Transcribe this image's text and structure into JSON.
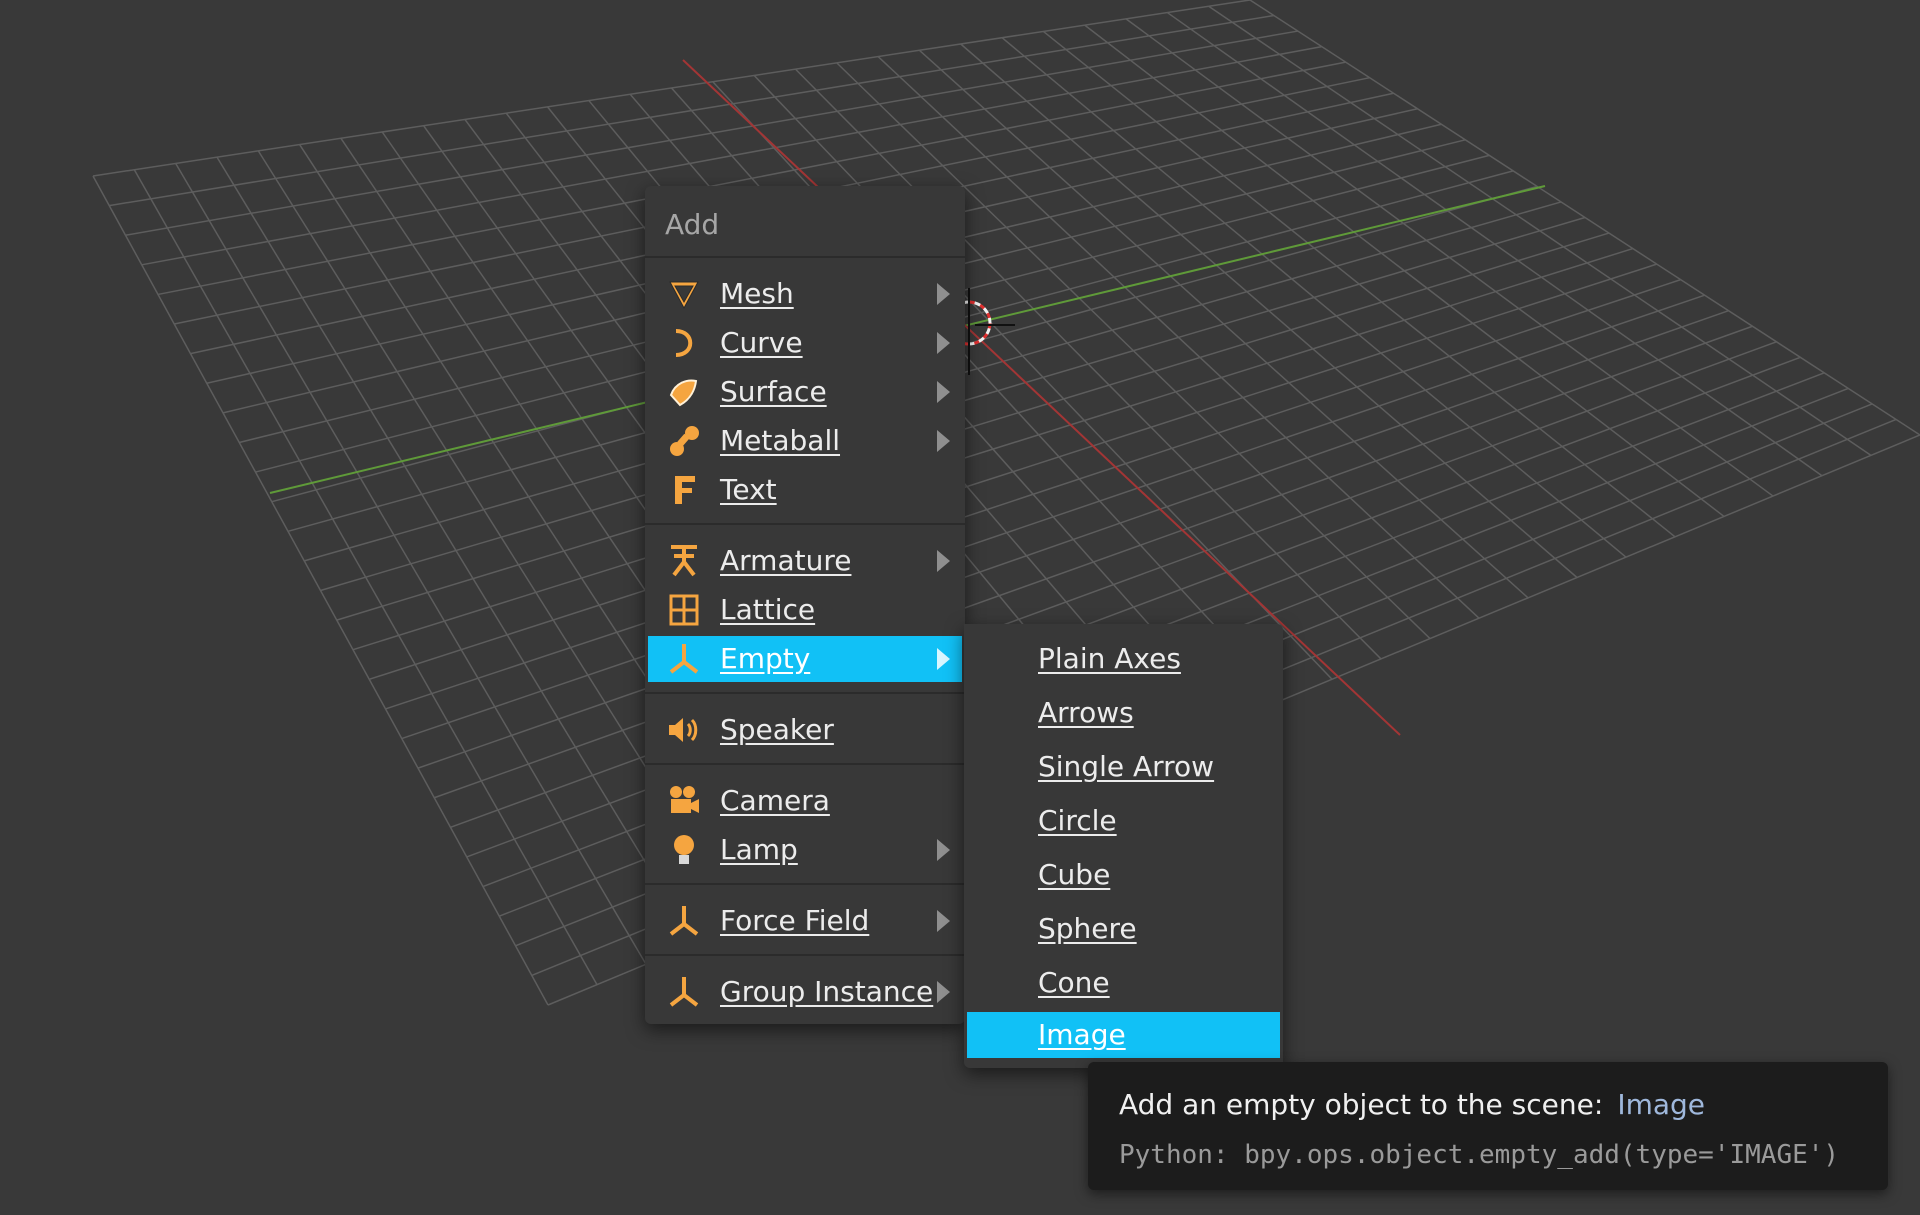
{
  "viewport": {
    "background": "#393939",
    "grid_color": "#5d5d5d",
    "x_axis_color": "#a33535",
    "y_axis_color": "#5f9a39"
  },
  "add_menu": {
    "title": "Add",
    "items": [
      {
        "label": "Mesh",
        "icon": "mesh-icon",
        "submenu": true
      },
      {
        "label": "Curve",
        "icon": "curve-icon",
        "submenu": true
      },
      {
        "label": "Surface",
        "icon": "surface-icon",
        "submenu": true
      },
      {
        "label": "Metaball",
        "icon": "metaball-icon",
        "submenu": true
      },
      {
        "label": "Text",
        "icon": "text-icon",
        "submenu": false
      },
      {
        "label": "Armature",
        "icon": "armature-icon",
        "submenu": true
      },
      {
        "label": "Lattice",
        "icon": "lattice-icon",
        "submenu": false
      },
      {
        "label": "Empty",
        "icon": "empty-icon",
        "submenu": true,
        "active": true
      },
      {
        "label": "Speaker",
        "icon": "speaker-icon",
        "submenu": false
      },
      {
        "label": "Camera",
        "icon": "camera-icon",
        "submenu": false
      },
      {
        "label": "Lamp",
        "icon": "lamp-icon",
        "submenu": true
      },
      {
        "label": "Force Field",
        "icon": "force-field-icon",
        "submenu": true
      },
      {
        "label": "Group Instance",
        "icon": "group-instance-icon",
        "submenu": true
      }
    ]
  },
  "empty_submenu": {
    "items": [
      "Plain Axes",
      "Arrows",
      "Single Arrow",
      "Circle",
      "Cube",
      "Sphere",
      "Cone",
      "Image"
    ],
    "active": "Image"
  },
  "tooltip": {
    "description": "Add an empty object to the scene:",
    "value": "Image",
    "python": "Python: bpy.ops.object.empty_add(type='IMAGE')"
  },
  "colors": {
    "highlight": "#11c1f6",
    "menu_bg": "#383838",
    "icon_orange": "#f5a540"
  }
}
